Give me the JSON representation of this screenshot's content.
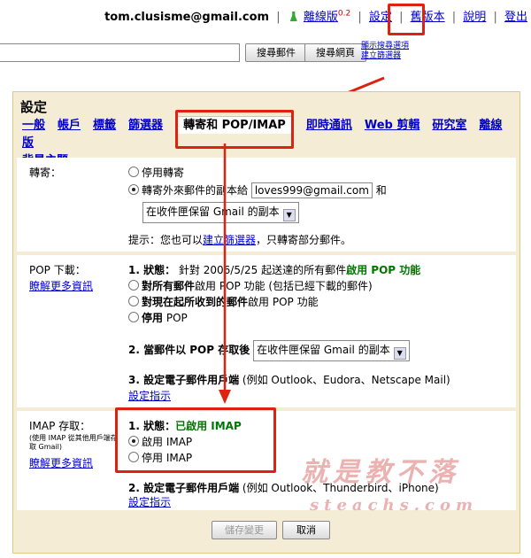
{
  "topbar": {
    "email": "tom.clusisme@gmail.com",
    "offline": "離線版",
    "offline_ver": "0.2",
    "settings": "設定",
    "old_version": "舊版本",
    "help": "說明",
    "signout": "登出"
  },
  "search": {
    "search_mail": "搜尋郵件",
    "search_web": "搜尋網頁",
    "show_options": "顯示搜尋選項",
    "create_filter": "建立篩選器"
  },
  "settings": {
    "title": "設定",
    "tabs": [
      "一般",
      "帳戶",
      "標籤",
      "篩選器",
      "轉寄和 POP/IMAP",
      "即時通訊",
      "Web 剪輯",
      "研究室",
      "離線版",
      "背景主題"
    ],
    "active_tab": "轉寄和 POP/IMAP"
  },
  "forwarding": {
    "label": "轉寄：",
    "opt_disable": "停用轉寄",
    "opt_forward": "轉寄外來郵件的副本給",
    "forward_to": "loves999@gmail.com",
    "and": "和",
    "keep_select": "在收件匣保留 Gmail 的副本",
    "tip_prefix": "提示：您也可以",
    "tip_link": "建立篩選器",
    "tip_suffix": "，只轉寄部分郵件。"
  },
  "pop": {
    "label": "POP 下載：",
    "learn_more": "瞭解更多資訊",
    "status_prefix": "1. 狀態：",
    "status_text": "針對 2006/5/25 起送達的所有郵件",
    "status_value": "啟用 POP 功能",
    "opt_all_bold": "對所有郵件",
    "opt_all_rest": "啟用 POP 功能 (包括已經下載的郵件)",
    "opt_now_bold": "對現在起所收到的郵件",
    "opt_now_rest": "啟用 POP 功能",
    "opt_disable_bold": "停用",
    "opt_disable_rest": "POP",
    "when_label": "2. 當郵件以 POP 存取後",
    "when_select": "在收件匣保留 Gmail 的副本",
    "client_label": "3. 設定電子郵件用戶端",
    "client_examples": "(例如 Outlook、Eudora、Netscape Mail)",
    "client_link": "設定指示"
  },
  "imap": {
    "label": "IMAP 存取：",
    "sublabel": "(使用 IMAP 從其他用戶端存取 Gmail)",
    "learn_more": "瞭解更多資訊",
    "status_prefix": "1. 狀態：",
    "status_value": "已啟用 IMAP",
    "opt_enable": "啟用 IMAP",
    "opt_disable": "停用 IMAP",
    "client_label": "2. 設定電子郵件用戶端",
    "client_examples": "(例如 Outlook、Thunderbird、iPhone)",
    "client_link": "設定指示"
  },
  "footer": {
    "save": "儲存變更",
    "cancel": "取消"
  },
  "watermark": {
    "cn": "就是教不落",
    "url": "steachs.com"
  },
  "colors": {
    "highlight": "#d21",
    "panel": "#f5ecd5",
    "link": "#0000cc",
    "status_green": "#070"
  }
}
